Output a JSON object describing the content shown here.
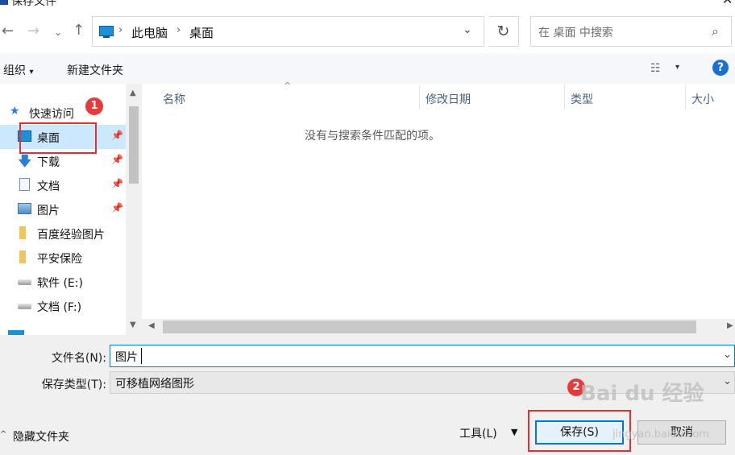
{
  "window": {
    "title": "保存文件"
  },
  "address": {
    "crumbs": [
      "此电脑",
      "桌面"
    ],
    "search_placeholder": "在 桌面 中搜索"
  },
  "toolbar": {
    "organize": "组织",
    "new_folder": "新建文件夹",
    "help": "?"
  },
  "nav": {
    "quick_access": "快速访问",
    "items": [
      {
        "label": "桌面",
        "icon": "desktop-icon",
        "pinned": true,
        "selected": true
      },
      {
        "label": "下载",
        "icon": "download-arrow-icon",
        "pinned": true
      },
      {
        "label": "文档",
        "icon": "document-icon",
        "pinned": true
      },
      {
        "label": "图片",
        "icon": "picture-icon",
        "pinned": true
      },
      {
        "label": "百度经验图片",
        "icon": "folder-icon"
      },
      {
        "label": "平安保险",
        "icon": "folder-icon"
      },
      {
        "label": "软件 (E:)",
        "icon": "drive-icon"
      },
      {
        "label": "文档 (F:)",
        "icon": "drive-icon"
      }
    ]
  },
  "list": {
    "columns": [
      "名称",
      "修改日期",
      "类型",
      "大小"
    ],
    "empty_message": "没有与搜索条件匹配的项。"
  },
  "form": {
    "filename_label": "文件名(N):",
    "filename_value": "图片",
    "filetype_label": "保存类型(T):",
    "filetype_value": "可移植网络图形"
  },
  "footer": {
    "hide_folders": "隐藏文件夹",
    "tools": "工具(L)",
    "save": "保存(S)",
    "cancel": "取消"
  },
  "annotations": {
    "marker1": "1",
    "marker2": "2"
  },
  "watermark": {
    "main": "Bai du 经验",
    "sub": "jingyan.baidu.com"
  },
  "colors": {
    "accent": "#0078d7",
    "selection": "#cce8ff",
    "annotation": "#e03030"
  }
}
